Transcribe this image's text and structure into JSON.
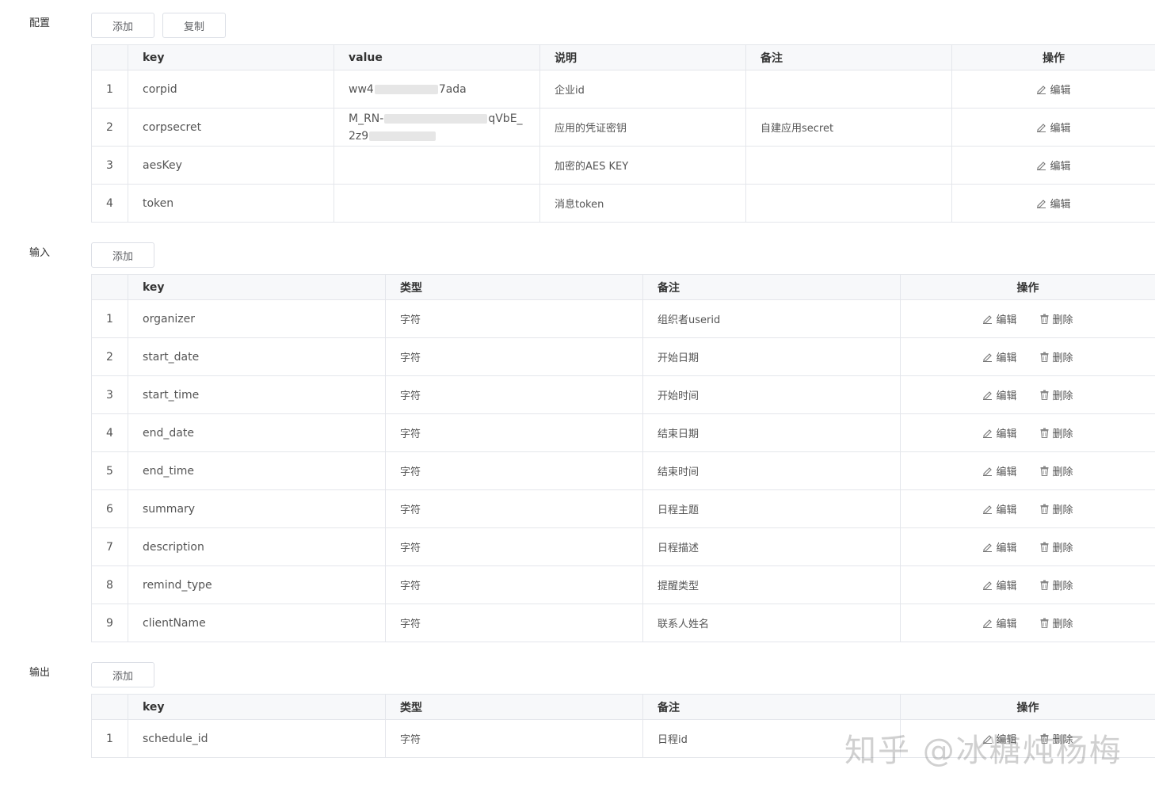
{
  "config": {
    "label": "配置",
    "add_button": "添加",
    "copy_button": "复制",
    "headers": {
      "key": "key",
      "value": "value",
      "desc": "说明",
      "remark": "备注",
      "ops": "操作"
    },
    "rows": [
      {
        "index": "1",
        "key": "corpid",
        "value_a": "ww4",
        "value_b": "7ada",
        "desc": "企业id",
        "remark": ""
      },
      {
        "index": "2",
        "key": "corpsecret",
        "value_a": "M_RN-",
        "value_b": "qVbE_",
        "value_c": "2z9",
        "desc": "应用的凭证密钥",
        "remark": "自建应用secret"
      },
      {
        "index": "3",
        "key": "aesKey",
        "value_a": "",
        "desc": "加密的AES KEY",
        "remark": ""
      },
      {
        "index": "4",
        "key": "token",
        "value_a": "",
        "desc": "消息token",
        "remark": ""
      }
    ],
    "edit_label": "编辑"
  },
  "input": {
    "label": "输入",
    "add_button": "添加",
    "headers": {
      "key": "key",
      "type": "类型",
      "remark": "备注",
      "ops": "操作"
    },
    "rows": [
      {
        "index": "1",
        "key": "organizer",
        "type": "字符",
        "remark": "组织者userid"
      },
      {
        "index": "2",
        "key": "start_date",
        "type": "字符",
        "remark": "开始日期"
      },
      {
        "index": "3",
        "key": "start_time",
        "type": "字符",
        "remark": "开始时间"
      },
      {
        "index": "4",
        "key": "end_date",
        "type": "字符",
        "remark": "结束日期"
      },
      {
        "index": "5",
        "key": "end_time",
        "type": "字符",
        "remark": "结束时间"
      },
      {
        "index": "6",
        "key": "summary",
        "type": "字符",
        "remark": "日程主题"
      },
      {
        "index": "7",
        "key": "description",
        "type": "字符",
        "remark": "日程描述"
      },
      {
        "index": "8",
        "key": "remind_type",
        "type": "字符",
        "remark": "提醒类型"
      },
      {
        "index": "9",
        "key": "clientName",
        "type": "字符",
        "remark": "联系人姓名"
      }
    ],
    "edit_label": "编辑",
    "delete_label": "删除"
  },
  "output": {
    "label": "输出",
    "add_button": "添加",
    "headers": {
      "key": "key",
      "type": "类型",
      "remark": "备注",
      "ops": "操作"
    },
    "rows": [
      {
        "index": "1",
        "key": "schedule_id",
        "type": "字符",
        "remark": "日程id"
      }
    ],
    "edit_label": "编辑",
    "delete_label": "删除"
  },
  "watermark": "知乎 @冰糖炖杨梅",
  "icons": {
    "edit": "pencil-icon",
    "delete": "trash-icon"
  }
}
